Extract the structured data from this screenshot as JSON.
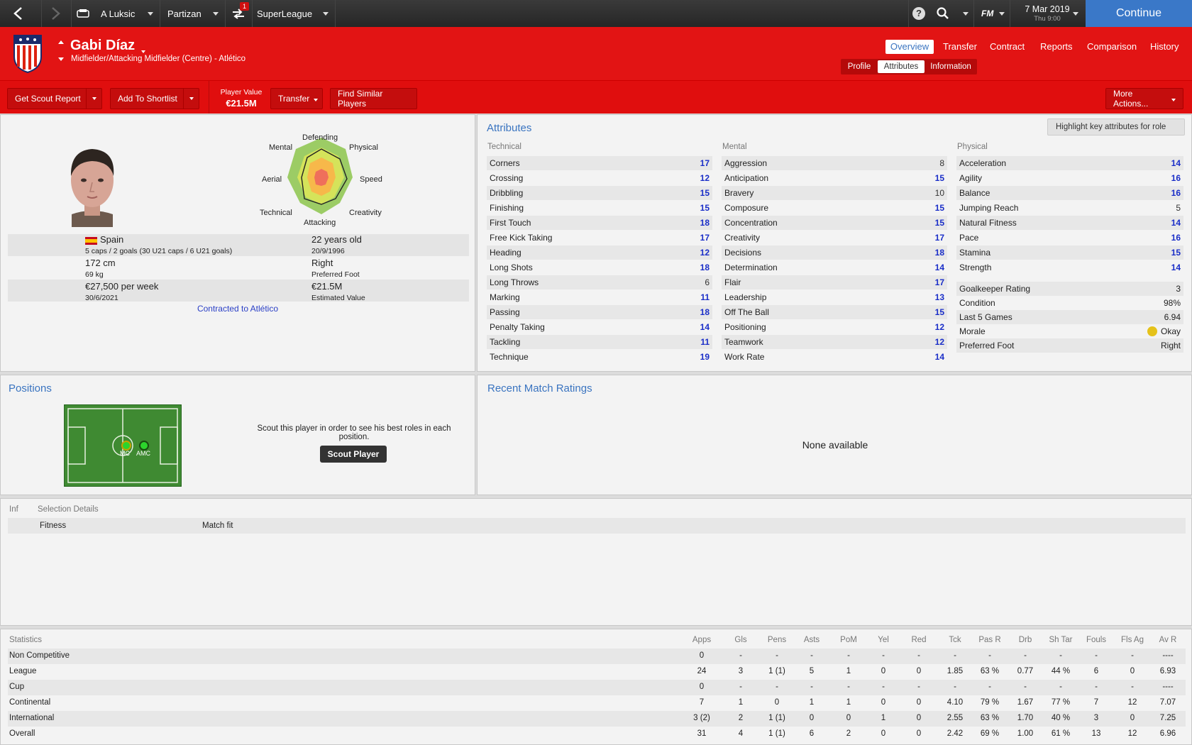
{
  "topbar": {
    "manager": "A Luksic",
    "club": "Partizan",
    "inbox_badge": "1",
    "league": "SuperLeague",
    "date": "7 Mar 2019",
    "time": "Thu 9:00",
    "fm_label": "FM",
    "continue": "Continue"
  },
  "player": {
    "name": "Gabi Díaz",
    "position": "Midfielder/Attacking Midfielder (Centre) - Atlético"
  },
  "nav": {
    "tabs": [
      "Overview",
      "Transfer",
      "Contract",
      "Reports",
      "Comparison",
      "History"
    ],
    "subtabs": [
      "Profile",
      "Attributes",
      "Information"
    ]
  },
  "actions": {
    "scout_report": "Get Scout Report",
    "shortlist": "Add To Shortlist",
    "value_label": "Player Value",
    "value": "€21.5M",
    "transfer": "Transfer",
    "similar": "Find Similar Players",
    "more": "More Actions..."
  },
  "radar": {
    "labels": [
      "Defending",
      "Physical",
      "Speed",
      "Creativity",
      "Attacking",
      "Technical",
      "Aerial",
      "Mental"
    ]
  },
  "profile": {
    "nationality": "Spain",
    "caps": "5 caps / 2 goals (30 U21 caps / 6 U21 goals)",
    "age": "22 years old",
    "dob": "20/9/1996",
    "height": "172 cm",
    "weight": "69 kg",
    "foot": "Right",
    "foot_label": "Preferred Foot",
    "wage": "€27,500 per week",
    "contract_end": "30/6/2021",
    "est_value": "€21.5M",
    "est_value_label": "Estimated Value",
    "contracted": "Contracted to Atlético"
  },
  "attributes": {
    "title": "Attributes",
    "highlight": "Highlight key attributes for role",
    "technical_title": "Technical",
    "mental_title": "Mental",
    "physical_title": "Physical",
    "technical": [
      [
        "Corners",
        "17"
      ],
      [
        "Crossing",
        "12"
      ],
      [
        "Dribbling",
        "15"
      ],
      [
        "Finishing",
        "15"
      ],
      [
        "First Touch",
        "18"
      ],
      [
        "Free Kick Taking",
        "17"
      ],
      [
        "Heading",
        "12"
      ],
      [
        "Long Shots",
        "18"
      ],
      [
        "Long Throws",
        "6"
      ],
      [
        "Marking",
        "11"
      ],
      [
        "Passing",
        "18"
      ],
      [
        "Penalty Taking",
        "14"
      ],
      [
        "Tackling",
        "11"
      ],
      [
        "Technique",
        "19"
      ]
    ],
    "mental": [
      [
        "Aggression",
        "8"
      ],
      [
        "Anticipation",
        "15"
      ],
      [
        "Bravery",
        "10"
      ],
      [
        "Composure",
        "15"
      ],
      [
        "Concentration",
        "15"
      ],
      [
        "Creativity",
        "17"
      ],
      [
        "Decisions",
        "18"
      ],
      [
        "Determination",
        "14"
      ],
      [
        "Flair",
        "17"
      ],
      [
        "Leadership",
        "13"
      ],
      [
        "Off The Ball",
        "15"
      ],
      [
        "Positioning",
        "12"
      ],
      [
        "Teamwork",
        "12"
      ],
      [
        "Work Rate",
        "14"
      ]
    ],
    "physical": [
      [
        "Acceleration",
        "14"
      ],
      [
        "Agility",
        "16"
      ],
      [
        "Balance",
        "16"
      ],
      [
        "Jumping Reach",
        "5"
      ],
      [
        "Natural Fitness",
        "14"
      ],
      [
        "Pace",
        "16"
      ],
      [
        "Stamina",
        "15"
      ],
      [
        "Strength",
        "14"
      ]
    ],
    "extra": [
      [
        "Goalkeeper Rating",
        "3"
      ],
      [
        "Condition",
        "98%"
      ],
      [
        "Last 5 Games",
        "6.94"
      ],
      [
        "Morale",
        "Okay"
      ],
      [
        "Preferred Foot",
        "Right"
      ]
    ]
  },
  "positions": {
    "title": "Positions",
    "pos1": "MC",
    "pos2": "AMC",
    "scout_text": "Scout this player in order to see his best roles in each position.",
    "scout_btn": "Scout Player"
  },
  "ratings": {
    "title": "Recent Match Ratings",
    "none": "None available"
  },
  "selection": {
    "inf": "Inf",
    "title": "Selection Details",
    "fitness_label": "Fitness",
    "fitness_value": "Match fit"
  },
  "stats": {
    "title": "Statistics",
    "headers": [
      "Apps",
      "Gls",
      "Pens",
      "Asts",
      "PoM",
      "Yel",
      "Red",
      "Tck",
      "Pas R",
      "Drb",
      "Sh Tar",
      "Fouls",
      "Fls Ag",
      "Av R"
    ],
    "rows": [
      {
        "label": "Non Competitive",
        "cells": [
          "0",
          "-",
          "-",
          "-",
          "-",
          "-",
          "-",
          "-",
          "-",
          "-",
          "-",
          "-",
          "-",
          "----"
        ]
      },
      {
        "label": "League",
        "cells": [
          "24",
          "3",
          "1 (1)",
          "5",
          "1",
          "0",
          "0",
          "1.85",
          "63 %",
          "0.77",
          "44 %",
          "6",
          "0",
          "6.93"
        ]
      },
      {
        "label": "Cup",
        "cells": [
          "0",
          "-",
          "-",
          "-",
          "-",
          "-",
          "-",
          "-",
          "-",
          "-",
          "-",
          "-",
          "-",
          "----"
        ]
      },
      {
        "label": "Continental",
        "cells": [
          "7",
          "1",
          "0",
          "1",
          "1",
          "0",
          "0",
          "4.10",
          "79 %",
          "1.67",
          "77 %",
          "7",
          "12",
          "7.07"
        ]
      },
      {
        "label": "International",
        "cells": [
          "3 (2)",
          "2",
          "1 (1)",
          "0",
          "0",
          "1",
          "0",
          "2.55",
          "63 %",
          "1.70",
          "40 %",
          "3",
          "0",
          "7.25"
        ]
      },
      {
        "label": "Overall",
        "cells": [
          "31",
          "4",
          "1 (1)",
          "6",
          "2",
          "0",
          "0",
          "2.42",
          "69 %",
          "1.00",
          "61 %",
          "13",
          "12",
          "6.96"
        ]
      }
    ]
  }
}
